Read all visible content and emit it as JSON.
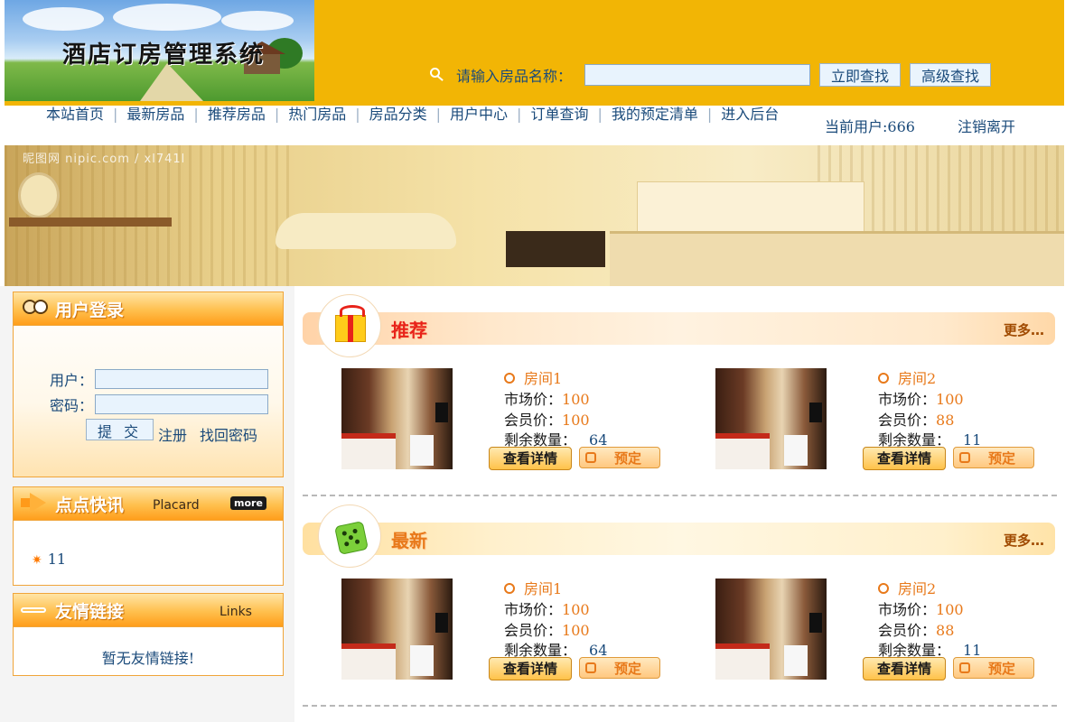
{
  "header": {
    "logo_text": "酒店订房管理系统",
    "search_label": "请输入房品名称：",
    "search_placeholder": "",
    "search_button": "立即查找",
    "advanced_button": "高级查找"
  },
  "nav": {
    "items": [
      "本站首页",
      "最新房品",
      "推荐房品",
      "热门房品",
      "房品分类",
      "用户中心",
      "订单查询",
      "我的预定清单",
      "进入后台"
    ],
    "current_user_label": "当前用户:666",
    "logout_label": "注销离开"
  },
  "banner": {
    "watermark": "昵图网 nipic.com / xl741l"
  },
  "login": {
    "title": "用户登录",
    "user_label": "用户：",
    "password_label": "密码：",
    "submit": "提 交",
    "register": "注册",
    "recover": "找回密码"
  },
  "placard": {
    "title": "点点快讯",
    "subtitle": "Placard",
    "more": "more",
    "items": [
      "11"
    ]
  },
  "links": {
    "title": "友情链接",
    "subtitle": "Links",
    "empty_text": "暂无友情链接!"
  },
  "sections": [
    {
      "title": "推荐",
      "more": "更多…",
      "rooms": [
        {
          "name": "房间1",
          "market_label": "市场价：",
          "market_price": "100",
          "member_label": "会员价：",
          "member_price": "100",
          "stock_label": "剩余数量：",
          "stock": "64",
          "detail": "查看详情",
          "book": "预定"
        },
        {
          "name": "房间2",
          "market_label": "市场价：",
          "market_price": "100",
          "member_label": "会员价：",
          "member_price": "88",
          "stock_label": "剩余数量：",
          "stock": "11",
          "detail": "查看详情",
          "book": "预定"
        }
      ]
    },
    {
      "title": "最新",
      "more": "更多…",
      "rooms": [
        {
          "name": "房间1",
          "market_label": "市场价：",
          "market_price": "100",
          "member_label": "会员价：",
          "member_price": "100",
          "stock_label": "剩余数量：",
          "stock": "64",
          "detail": "查看详情",
          "book": "预定"
        },
        {
          "name": "房间2",
          "market_label": "市场价：",
          "market_price": "100",
          "member_label": "会员价：",
          "member_price": "88",
          "stock_label": "剩余数量：",
          "stock": "11",
          "detail": "查看详情",
          "book": "预定"
        }
      ]
    }
  ],
  "colors": {
    "header_bg": "#f2b505",
    "link_text": "#1a4a7a",
    "accent_orange": "#e8791a",
    "panel_border": "#f0a53a"
  }
}
